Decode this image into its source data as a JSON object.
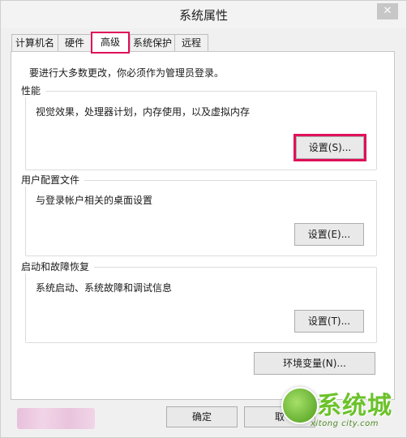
{
  "window": {
    "title": "系统属性",
    "close_symbol": "✕"
  },
  "tabs": [
    {
      "label": "计算机名"
    },
    {
      "label": "硬件"
    },
    {
      "label": "高级",
      "selected": true
    },
    {
      "label": "系统保护"
    },
    {
      "label": "远程"
    }
  ],
  "advanced": {
    "notice": "要进行大多数更改，你必须作为管理员登录。",
    "performance": {
      "title": "性能",
      "description": "视觉效果，处理器计划，内存使用，以及虚拟内存",
      "button": "设置(S)..."
    },
    "user_profiles": {
      "title": "用户配置文件",
      "description": "与登录帐户相关的桌面设置",
      "button": "设置(E)..."
    },
    "startup_recovery": {
      "title": "启动和故障恢复",
      "description": "系统启动、系统故障和调试信息",
      "button": "设置(T)..."
    },
    "env_button": "环境变量(N)..."
  },
  "footer": {
    "ok": "确定",
    "cancel": "取"
  },
  "watermark": {
    "logo_text": "系统城",
    "url": "xitong city.com"
  },
  "colors": {
    "highlight": "#e0105a",
    "background": "#f0f0f0"
  }
}
